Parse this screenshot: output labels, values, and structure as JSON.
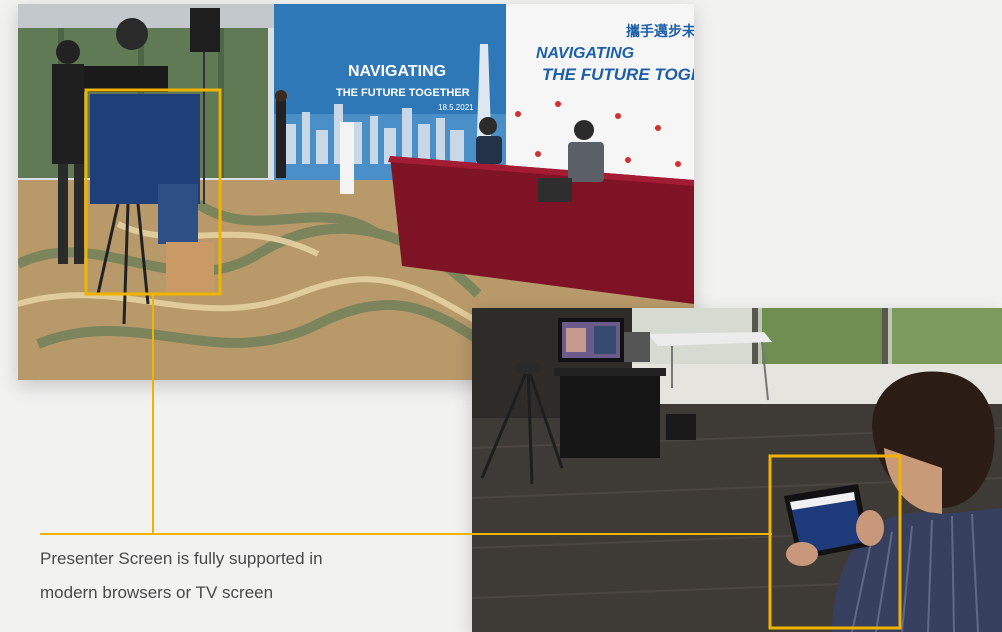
{
  "event_photo": {
    "backdrop_title_line1": "NAVIGATING",
    "backdrop_title_line2": "THE FUTURE TOGETHER",
    "backdrop_date": "18.5.2021",
    "backdrop_chinese": "攜手邁步未來",
    "highlight_color": "#f0b400"
  },
  "office_photo": {
    "highlight_color": "#f0b400"
  },
  "caption": {
    "line1": "Presenter Screen is fully supported in",
    "line2": "modern browsers or TV screen"
  },
  "colors": {
    "accent": "#f0b400",
    "caption_text": "#4a4a4a",
    "background": "#f2f2f1"
  }
}
